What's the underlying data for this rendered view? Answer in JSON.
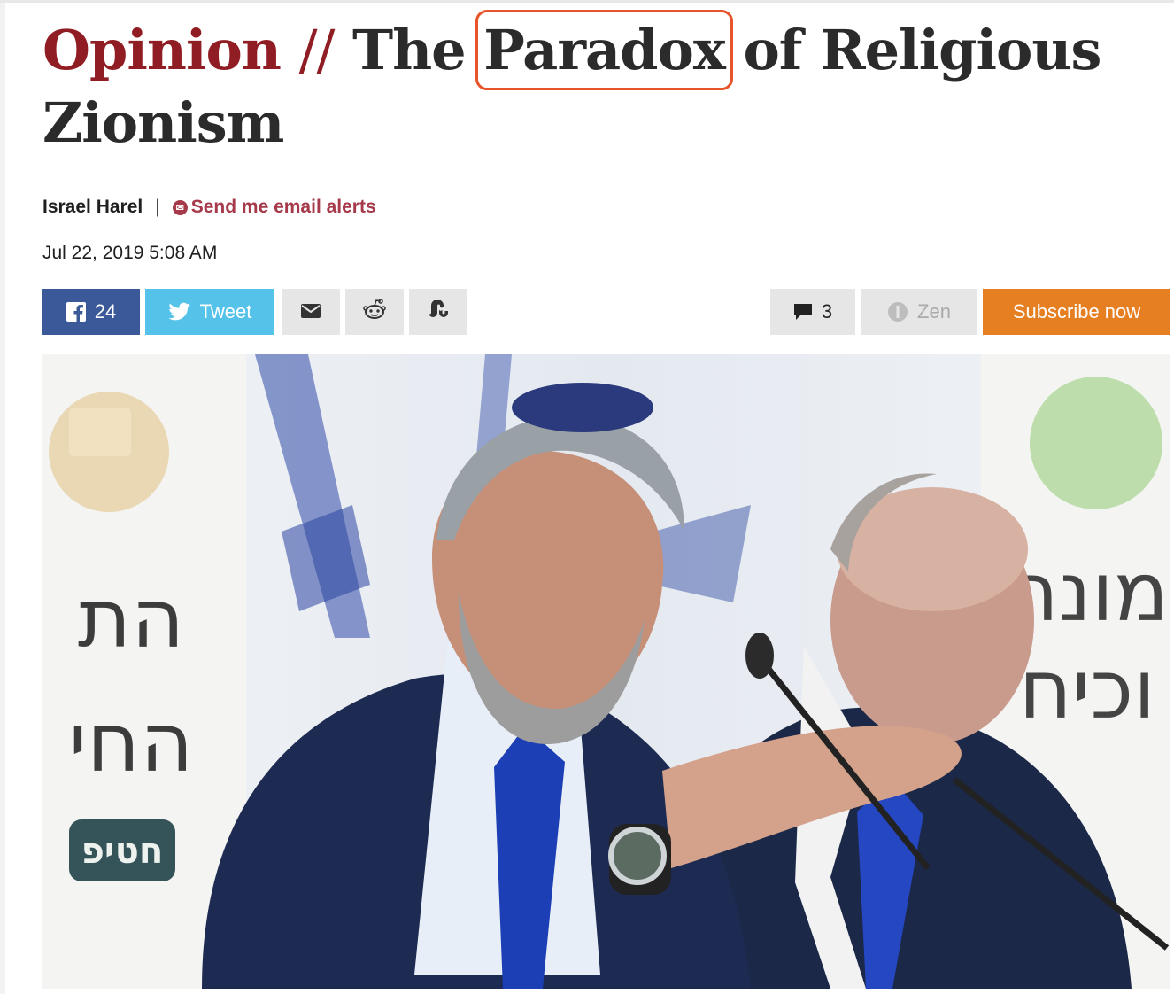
{
  "article": {
    "kicker": "Opinion",
    "separator": "//",
    "title_before": "The",
    "title_highlight": "Paradox",
    "title_after": "of Religious Zionism",
    "author": "Israel Harel",
    "pipe": "|",
    "alerts_label": "Send me email alerts",
    "date": "Jul 22, 2019 5:08 AM"
  },
  "share": {
    "facebook_count": "24",
    "tweet_label": "Tweet",
    "comments_count": "3",
    "zen_label": "Zen",
    "subscribe_label": "Subscribe now"
  },
  "photo": {
    "left_sign_lines": [
      "הת",
      "החי"
    ],
    "right_sign_lines": [
      "מונה",
      "וכיח"
    ],
    "left_badge_text": "חטיפ"
  },
  "colors": {
    "kicker": "#8f1d23",
    "highlight_box": "#e8542a",
    "alerts": "#a63a4b",
    "facebook": "#3b5998",
    "twitter": "#55c2ea",
    "subscribe": "#e67e22"
  }
}
